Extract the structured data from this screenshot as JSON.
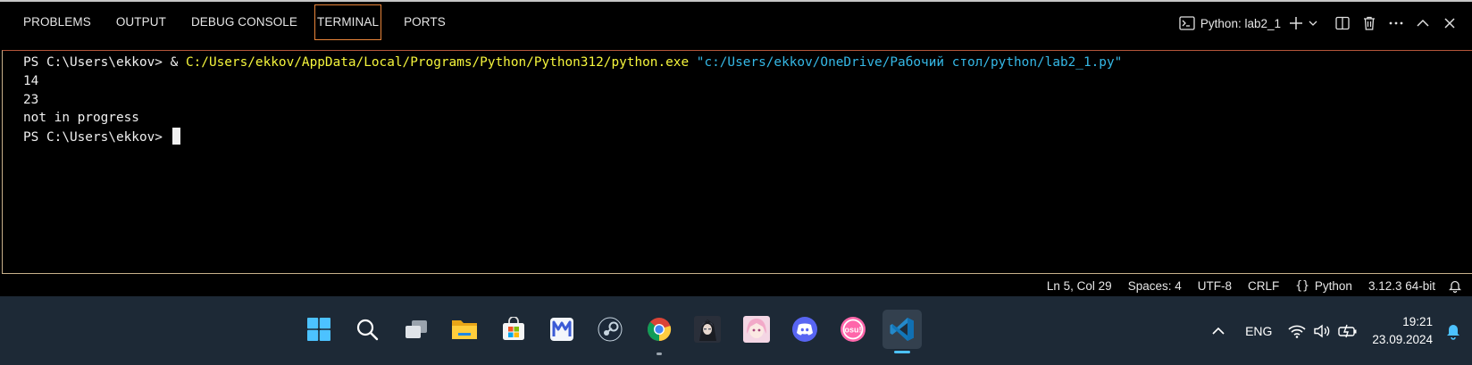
{
  "panel": {
    "tabs": [
      {
        "label": "PROBLEMS"
      },
      {
        "label": "OUTPUT"
      },
      {
        "label": "DEBUG CONSOLE"
      },
      {
        "label": "TERMINAL",
        "active": true
      },
      {
        "label": "PORTS"
      }
    ],
    "terminal_name": "Python: lab2_1",
    "actions": [
      "terminal-icon",
      "plus-icon",
      "chevron-down-icon",
      "split-icon",
      "trash-icon",
      "more-icon",
      "chevron-up-icon",
      "close-icon"
    ]
  },
  "terminal": {
    "prompt": "PS C:\\Users\\ekkov> ",
    "command_amp": "& ",
    "command_exe": "C:/Users/ekkov/AppData/Local/Programs/Python/Python312/python.exe",
    "command_arg": "\"c:/Users/ekkov/OneDrive/Рабочий стол/python/lab2_1.py\"",
    "output": [
      "14",
      "23",
      "not in progress"
    ],
    "prompt_last": "PS C:\\Users\\ekkov> "
  },
  "statusbar": {
    "position": "Ln 5, Col 29",
    "spaces": "Spaces: 4",
    "encoding": "UTF-8",
    "eol": "CRLF",
    "language": "Python",
    "interpreter": "3.12.3 64-bit"
  },
  "taskbar": {
    "apps": [
      "windows-start-icon",
      "search-icon",
      "task-view-icon",
      "file-explorer-icon",
      "microsoft-store-icon",
      "m-app-icon",
      "steam-icon",
      "chrome-icon",
      "game-avatar-icon",
      "anime-avatar-icon",
      "discord-icon",
      "osu-icon",
      "vscode-icon"
    ],
    "language": "ENG",
    "time": "19:21",
    "date": "23.09.2024"
  },
  "colors": {
    "prompt_path_yellow": "#f5f53c",
    "string_cyan": "#35b8e6",
    "active_tab_border": "#e8843a",
    "taskbar_bg": "#1d2936"
  }
}
